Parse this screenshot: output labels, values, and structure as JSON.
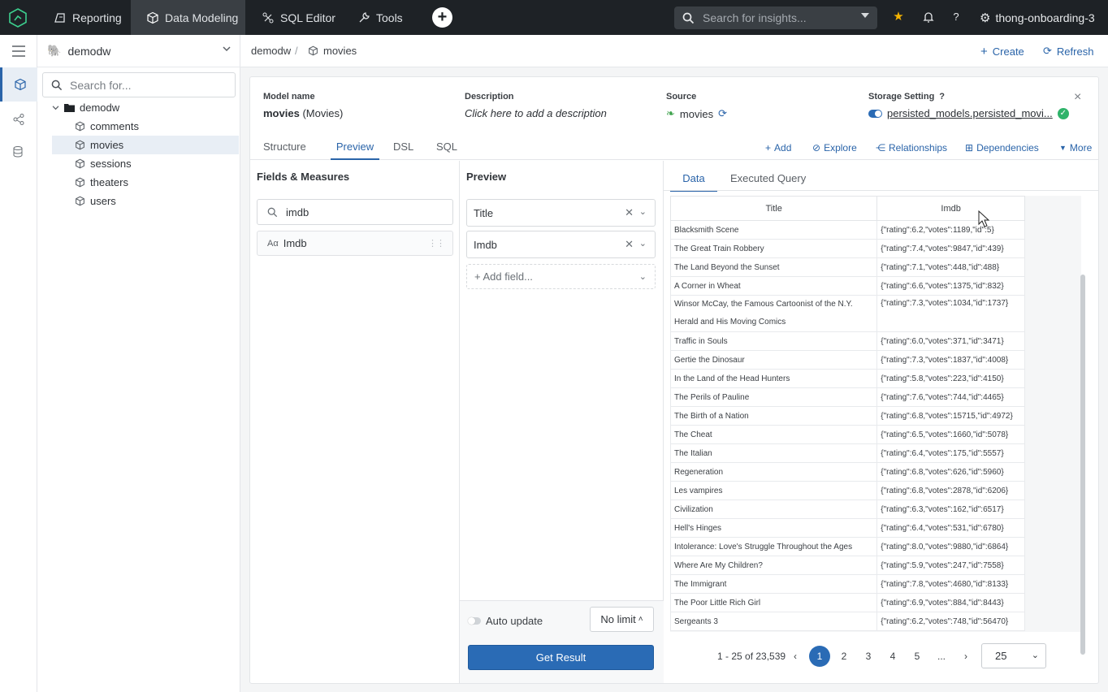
{
  "topbar": {
    "nav": [
      {
        "label": "Reporting",
        "icon": "reporting-icon"
      },
      {
        "label": "Data Modeling",
        "icon": "cube-icon"
      },
      {
        "label": "SQL Editor",
        "icon": "sql-editor-icon"
      },
      {
        "label": "Tools",
        "icon": "wrench-icon"
      }
    ],
    "search_placeholder": "Search for insights...",
    "workspace": "thong-onboarding-3"
  },
  "sidebar": {
    "datasource": "demodw",
    "search_placeholder": "Search for...",
    "tree": [
      {
        "label": "demodw",
        "type": "folder"
      },
      {
        "label": "comments",
        "type": "model"
      },
      {
        "label": "movies",
        "type": "model"
      },
      {
        "label": "sessions",
        "type": "model"
      },
      {
        "label": "theaters",
        "type": "model"
      },
      {
        "label": "users",
        "type": "model"
      }
    ]
  },
  "breadcrumb": {
    "root": "demodw",
    "current": "movies",
    "sep": "/"
  },
  "actions": {
    "create": "Create",
    "refresh": "Refresh"
  },
  "model": {
    "name_label": "Model name",
    "name": "movies",
    "name_suffix": "(Movies)",
    "desc_label": "Description",
    "desc_placeholder": "Click here to add a description",
    "source_label": "Source",
    "source": "movies",
    "storage_label": "Storage Setting",
    "storage_value": "persisted_models.persisted_movi..."
  },
  "tabs": [
    "Structure",
    "Preview",
    "DSL",
    "SQL"
  ],
  "tab_actions": [
    "Add",
    "Explore",
    "Relationships",
    "Dependencies",
    "More"
  ],
  "fields": {
    "title": "Fields & Measures",
    "search_value": "imdb",
    "item_type": "Aα",
    "item_label": "Imdb"
  },
  "preview": {
    "title": "Preview",
    "selected": [
      "Title",
      "Imdb"
    ],
    "add_field": "+ Add field...",
    "auto_update": "Auto update",
    "limit": "No limit",
    "get_result": "Get Result"
  },
  "data": {
    "tabs": [
      "Data",
      "Executed Query"
    ],
    "columns": [
      "Title",
      "Imdb"
    ],
    "rows": [
      [
        "Blacksmith Scene",
        "{\"rating\":6.2,\"votes\":1189,\"id\":5}"
      ],
      [
        "The Great Train Robbery",
        "{\"rating\":7.4,\"votes\":9847,\"id\":439}"
      ],
      [
        "The Land Beyond the Sunset",
        "{\"rating\":7.1,\"votes\":448,\"id\":488}"
      ],
      [
        "A Corner in Wheat",
        "{\"rating\":6.6,\"votes\":1375,\"id\":832}"
      ],
      [
        "Winsor McCay, the Famous Cartoonist of the N.Y. Herald and His Moving Comics",
        "{\"rating\":7.3,\"votes\":1034,\"id\":1737}"
      ],
      [
        "Traffic in Souls",
        "{\"rating\":6.0,\"votes\":371,\"id\":3471}"
      ],
      [
        "Gertie the Dinosaur",
        "{\"rating\":7.3,\"votes\":1837,\"id\":4008}"
      ],
      [
        "In the Land of the Head Hunters",
        "{\"rating\":5.8,\"votes\":223,\"id\":4150}"
      ],
      [
        "The Perils of Pauline",
        "{\"rating\":7.6,\"votes\":744,\"id\":4465}"
      ],
      [
        "The Birth of a Nation",
        "{\"rating\":6.8,\"votes\":15715,\"id\":4972}"
      ],
      [
        "The Cheat",
        "{\"rating\":6.5,\"votes\":1660,\"id\":5078}"
      ],
      [
        "The Italian",
        "{\"rating\":6.4,\"votes\":175,\"id\":5557}"
      ],
      [
        "Regeneration",
        "{\"rating\":6.8,\"votes\":626,\"id\":5960}"
      ],
      [
        "Les vampires",
        "{\"rating\":6.8,\"votes\":2878,\"id\":6206}"
      ],
      [
        "Civilization",
        "{\"rating\":6.3,\"votes\":162,\"id\":6517}"
      ],
      [
        "Hell's Hinges",
        "{\"rating\":6.4,\"votes\":531,\"id\":6780}"
      ],
      [
        "Intolerance: Love's Struggle Throughout the Ages",
        "{\"rating\":8.0,\"votes\":9880,\"id\":6864}"
      ],
      [
        "Where Are My Children?",
        "{\"rating\":5.9,\"votes\":247,\"id\":7558}"
      ],
      [
        "The Immigrant",
        "{\"rating\":7.8,\"votes\":4680,\"id\":8133}"
      ],
      [
        "The Poor Little Rich Girl",
        "{\"rating\":6.9,\"votes\":884,\"id\":8443}"
      ],
      [
        "Sergeants 3",
        "{\"rating\":6.2,\"votes\":748,\"id\":56470}"
      ]
    ],
    "pagination": {
      "info": "1 - 25 of 23,539",
      "pages": [
        "1",
        "2",
        "3",
        "4",
        "5",
        "..."
      ],
      "current": "1",
      "prev": "‹",
      "next": "›",
      "page_size": "25"
    }
  },
  "colors": {
    "accent": "#2a6bb5",
    "topbar": "#1e2226",
    "success": "#2fb36a",
    "star": "#f5b301"
  }
}
